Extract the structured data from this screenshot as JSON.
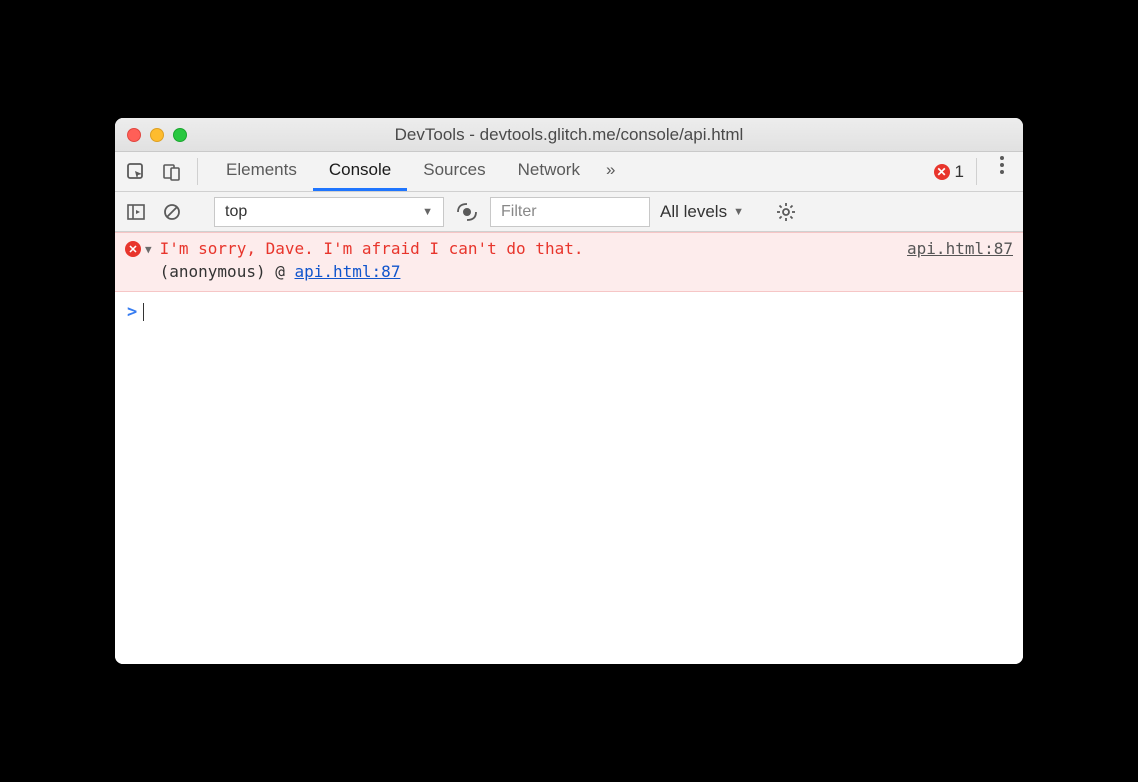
{
  "window": {
    "title": "DevTools - devtools.glitch.me/console/api.html"
  },
  "tabs": {
    "items": [
      "Elements",
      "Console",
      "Sources",
      "Network"
    ],
    "active": "Console",
    "overflow_glyph": "»"
  },
  "error_badge": {
    "count": "1"
  },
  "filterbar": {
    "context": "top",
    "filter_placeholder": "Filter",
    "levels_label": "All levels"
  },
  "console": {
    "error": {
      "message": "I'm sorry, Dave. I'm afraid I can't do that.",
      "source": "api.html:87",
      "trace_prefix": "(anonymous) @ ",
      "trace_link": "api.html:87"
    },
    "prompt_glyph": ">"
  }
}
